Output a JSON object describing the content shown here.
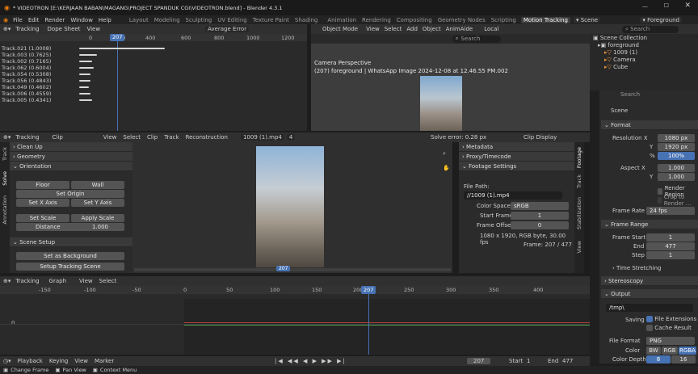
{
  "title": "* VIDEOTRON [E:\\KERJAAN BABAN\\MAGANG\\PROJECT SPANDUK CGI\\VIDEOTRON.blend] - Blender 4.3.1",
  "menus": [
    "File",
    "Edit",
    "Render",
    "Window",
    "Help"
  ],
  "workspaces": [
    "Layout",
    "Modeling",
    "Sculpting",
    "UV Editing",
    "Texture Paint",
    "Shading",
    "Animation",
    "Rendering",
    "Compositing",
    "Geometry Nodes",
    "Scripting",
    "Motion Tracking"
  ],
  "active_workspace": "Motion Tracking",
  "scene_name": "Scene",
  "view_layer": "Foreground",
  "search_placeholder": "Search",
  "dopesheet": {
    "editor": "Tracking",
    "mode": "Dope Sheet",
    "view": "View",
    "sort": "Average Error",
    "frame": "207",
    "ruler": [
      "0",
      "200",
      "400",
      "600",
      "800",
      "1000",
      "1200"
    ],
    "tracks": [
      "Track.021 (1.0008)",
      "Track.003 (0.7625)",
      "Track.002 (0.7165)",
      "Track.062 (0.6004)",
      "Track.054 (0.5308)",
      "Track.056 (0.4843)",
      "Track.049 (0.4602)",
      "Track.006 (0.4559)",
      "Track.005 (0.4341)"
    ]
  },
  "viewport": {
    "mode": "Object Mode",
    "menus": [
      "View",
      "Select",
      "Add",
      "Object",
      "AnimAide"
    ],
    "transform": "Local",
    "camera_label": "Camera Perspective",
    "object_label": "(207) foreground | WhatsApp Image 2024-12-08 at 12.46.55 PM.002"
  },
  "outliner": {
    "title": "Scene Collection",
    "items": [
      "foreground",
      "1009 (1)",
      "Camera",
      "Cube"
    ]
  },
  "clip": {
    "editor": "Tracking",
    "mode": "Clip",
    "menus": [
      "View",
      "Select",
      "Clip",
      "Track",
      "Reconstruction"
    ],
    "clip_name": "1009 (1).mp4",
    "users": "4",
    "solve_error": "Solve error: 0.28 px",
    "display": "Clip Display",
    "frame_badge": "207"
  },
  "solve_panel": {
    "sections": [
      "Clean Up",
      "Geometry",
      "Orientation"
    ],
    "floor": "Floor",
    "wall": "Wall",
    "set_origin": "Set Origin",
    "set_x": "Set X Axis",
    "set_y": "Set Y Axis",
    "set_scale": "Set Scale",
    "apply_scale": "Apply Scale",
    "distance_label": "Distance",
    "distance": "1.000",
    "scene_setup": "Scene Setup",
    "set_background": "Set as Background",
    "setup_scene": "Setup Tracking Scene"
  },
  "vtabs_left": [
    "Track",
    "Solve",
    "Annotation"
  ],
  "footage": {
    "metadata": "Metadata",
    "proxy": "Proxy/Timecode",
    "settings": "Footage Settings",
    "file_path_label": "File Path:",
    "file_path": "//1009 (1).mp4",
    "color_space_label": "Color Space",
    "color_space": "sRGB",
    "start_label": "Start Frame",
    "start": "1",
    "offset_label": "Frame Offset",
    "offset": "0",
    "info": "1080 x 1920, RGB byte, 30.00 fps",
    "frame_info": "Frame: 207 / 477"
  },
  "vtabs_right": [
    "Footage",
    "Track",
    "Stabilization",
    "View"
  ],
  "properties": {
    "scene": "Scene",
    "format": "Format",
    "res_x_label": "Resolution X",
    "res_x": "1080 px",
    "res_y_label": "Y",
    "res_y": "1920 px",
    "pct_label": "%",
    "pct": "100%",
    "aspect_x_label": "Aspect X",
    "aspect_x": "1.000",
    "aspect_y_label": "Y",
    "aspect_y": "1.000",
    "render_region": "Render Region",
    "crop": "Crop to Render ...",
    "frame_rate_label": "Frame Rate",
    "frame_rate": "24 fps",
    "frame_range": "Frame Range",
    "fs_label": "Frame Start",
    "fs": "1",
    "end_label": "End",
    "end": "477",
    "step_label": "Step",
    "step": "1",
    "time_stretching": "Time Stretching",
    "stereoscopy": "Stereoscopy",
    "output": "Output",
    "path": "/tmp\\",
    "saving_label": "Saving",
    "file_ext": "File Extensions",
    "cache": "Cache Result",
    "file_format_label": "File Format",
    "file_format": "PNG",
    "color_label": "Color",
    "color_opts": [
      "BW",
      "RGB",
      "RGBA"
    ],
    "depth_label": "Color Depth",
    "depth_opts": [
      "8",
      "16"
    ]
  },
  "graph": {
    "editor": "Tracking",
    "mode": "Graph",
    "menus": [
      "View",
      "Select"
    ],
    "frame": "207",
    "ruler": [
      "-150",
      "-100",
      "-50",
      "0",
      "50",
      "100",
      "150",
      "200",
      "250",
      "300",
      "350",
      "400"
    ],
    "y0": "0"
  },
  "timeline": {
    "menus": [
      "Playback",
      "Keying",
      "View",
      "Marker"
    ],
    "frame": "207",
    "start_label": "Start",
    "start": "1",
    "end_label": "End",
    "end": "477"
  },
  "status": {
    "items": [
      "Change Frame",
      "Pan View",
      "Context Menu"
    ]
  },
  "colors": {
    "accent": "#4772b3",
    "playhead": "#4772b3",
    "header": "#303030",
    "bg": "#1d1d1d"
  }
}
